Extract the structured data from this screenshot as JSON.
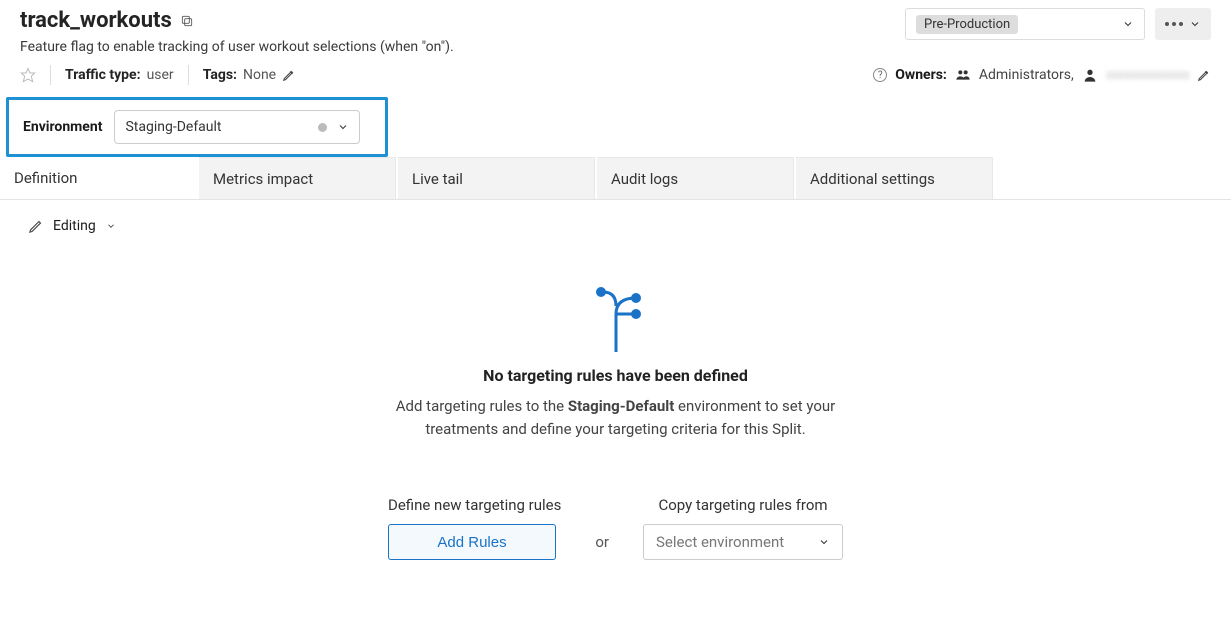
{
  "header": {
    "title": "track_workouts",
    "description": "Feature flag to enable tracking of user workout selections (when \"on\").",
    "env_dropdown_value": "Pre-Production"
  },
  "meta": {
    "traffic_type_label": "Traffic type:",
    "traffic_type_value": "user",
    "tags_label": "Tags:",
    "tags_value": "None",
    "owners_label": "Owners:",
    "owners_value": "Administrators,"
  },
  "environment": {
    "label": "Environment",
    "selected": "Staging-Default"
  },
  "tabs": [
    {
      "label": "Definition",
      "active": true
    },
    {
      "label": "Metrics impact",
      "active": false
    },
    {
      "label": "Live tail",
      "active": false
    },
    {
      "label": "Audit logs",
      "active": false
    },
    {
      "label": "Additional settings",
      "active": false
    }
  ],
  "editing": {
    "label": "Editing"
  },
  "empty_state": {
    "title": "No targeting rules have been defined",
    "desc_prefix": "Add targeting rules to the ",
    "desc_bold": "Staging-Default",
    "desc_suffix": " environment to set your treatments and define your targeting criteria for this Split."
  },
  "actions": {
    "define_label": "Define new targeting rules",
    "add_rules_button": "Add Rules",
    "or_text": "or",
    "copy_label": "Copy targeting rules from",
    "select_env_placeholder": "Select environment"
  }
}
